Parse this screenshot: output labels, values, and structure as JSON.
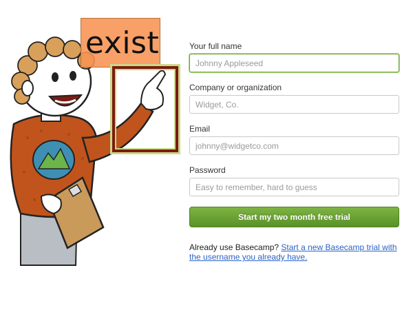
{
  "annotation": {
    "label": "exist"
  },
  "form": {
    "full_name": {
      "label": "Your full name",
      "placeholder": "Johnny Appleseed"
    },
    "company": {
      "label": "Company or organization",
      "placeholder": "Widget, Co."
    },
    "email": {
      "label": "Email",
      "placeholder": "johnny@widgetco.com"
    },
    "password": {
      "label": "Password",
      "placeholder": "Easy to remember, hard to guess"
    },
    "submit_label": "Start my two month free trial"
  },
  "footer": {
    "prefix": "Already use Basecamp?",
    "link_text": "Start a new Basecamp trial with the username you already have."
  },
  "colors": {
    "accent_green": "#5a9128",
    "link_blue": "#2b63c6",
    "annotation_box": "#7a1c0e",
    "annotation_label_bg": "#f79352"
  },
  "icons": {
    "illustration": "basecamp-mascot-illustration"
  }
}
